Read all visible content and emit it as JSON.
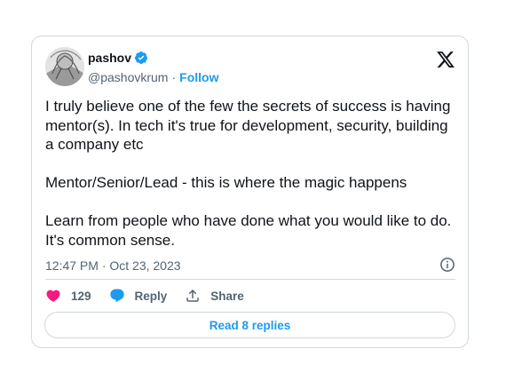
{
  "author": {
    "name": "pashov",
    "handle": "@pashovkrum",
    "separator": "·",
    "follow_label": "Follow",
    "verified": true,
    "avatar_icon": "user-avatar-icon"
  },
  "tweet": {
    "text": "I truly believe one of the few the secrets of success is having mentor(s). In tech it's true for development, security, building a company etc\n\nMentor/Senior/Lead - this is where the magic happens\n\nLearn from people who have done what you would like to do. It's common sense.",
    "timestamp": "12:47 PM · Oct 23, 2023"
  },
  "actions": {
    "like_count": "129",
    "reply_label": "Reply",
    "share_label": "Share"
  },
  "footer": {
    "read_replies_label": "Read 8 replies"
  },
  "colors": {
    "accent": "#1d9bf0",
    "like": "#f91880",
    "text": "#0f1419",
    "muted": "#536471",
    "border": "#cfd9de"
  },
  "icons": {
    "brand": "x-logo-icon",
    "verified": "verified-badge-icon",
    "info": "info-icon",
    "like": "heart-icon",
    "reply": "speech-bubble-icon",
    "share": "share-upload-icon"
  }
}
